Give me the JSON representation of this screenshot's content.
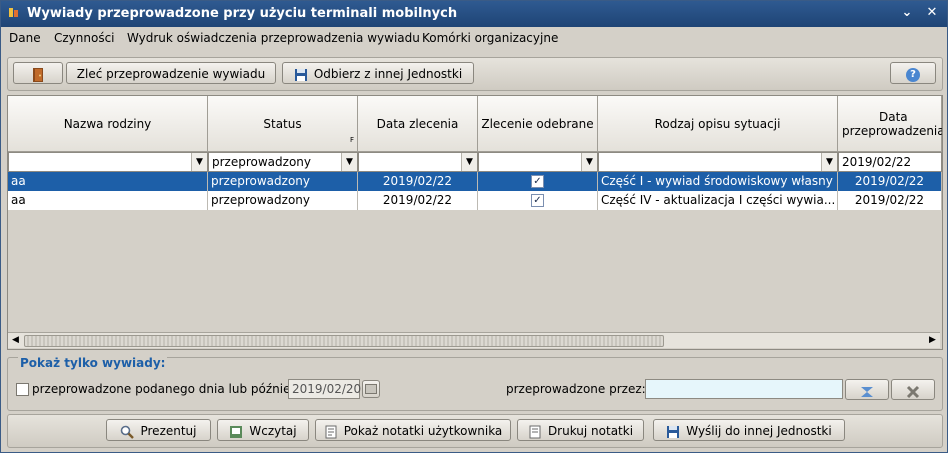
{
  "window": {
    "title": "Wywiady przeprowadzone przy użyciu terminali mobilnych",
    "collapse_glyph": "⌄",
    "close_glyph": "✕"
  },
  "menu": [
    {
      "label": "Dane"
    },
    {
      "label": "Czynności"
    },
    {
      "label": "Wydruk oświadczenia przeprowadzenia wywiadu"
    },
    {
      "label": "Komórki organizacyjne"
    }
  ],
  "toolbar": {
    "exit_icon": "door-exit-icon",
    "order_button": "Zleć przeprowadzenie wywiadu",
    "receive_button": "Odbierz z innej Jednostki",
    "help_icon": "help-icon",
    "help_glyph": "?"
  },
  "table": {
    "columns": [
      {
        "label": "Nazwa rodziny"
      },
      {
        "label": "Status",
        "marker": "F"
      },
      {
        "label": "Data zlecenia"
      },
      {
        "label": "Zlecenie odebrane"
      },
      {
        "label": "Rodzaj opisu sytuacji"
      },
      {
        "label": "Data przeprowadzenia"
      }
    ],
    "filters": [
      "",
      "przeprowadzony",
      "",
      "",
      "",
      "2019/02/22"
    ],
    "rows": [
      {
        "nazwa": "aa",
        "status": "przeprowadzony",
        "data_zlecenia": "2019/02/22",
        "odebrane": true,
        "rodzaj": "Część I - wywiad środowiskowy własny",
        "data_przeprowadzenia": "2019/02/22",
        "selected": true
      },
      {
        "nazwa": "aa",
        "status": "przeprowadzony",
        "data_zlecenia": "2019/02/22",
        "odebrane": true,
        "rodzaj": "Część IV - aktualizacja I części wywia...",
        "data_przeprowadzenia": "2019/02/22",
        "selected": false
      }
    ]
  },
  "filters_panel": {
    "legend": "Pokaż tylko wywiady:",
    "date_checkbox_label": "przeprowadzone podanego dnia lub później",
    "date_value": "2019/02/20",
    "by_label": "przeprowadzone przez:",
    "by_value": ""
  },
  "bottom": {
    "present": "Prezentuj",
    "load": "Wczytaj",
    "show_notes": "Pokaż notatki użytkownika",
    "print_notes": "Drukuj notatki",
    "send": "Wyślij do innej Jednostki"
  },
  "colors": {
    "title_bar": "#1e4475",
    "selection": "#1d5fa8",
    "legend_text": "#1d5fa8"
  }
}
